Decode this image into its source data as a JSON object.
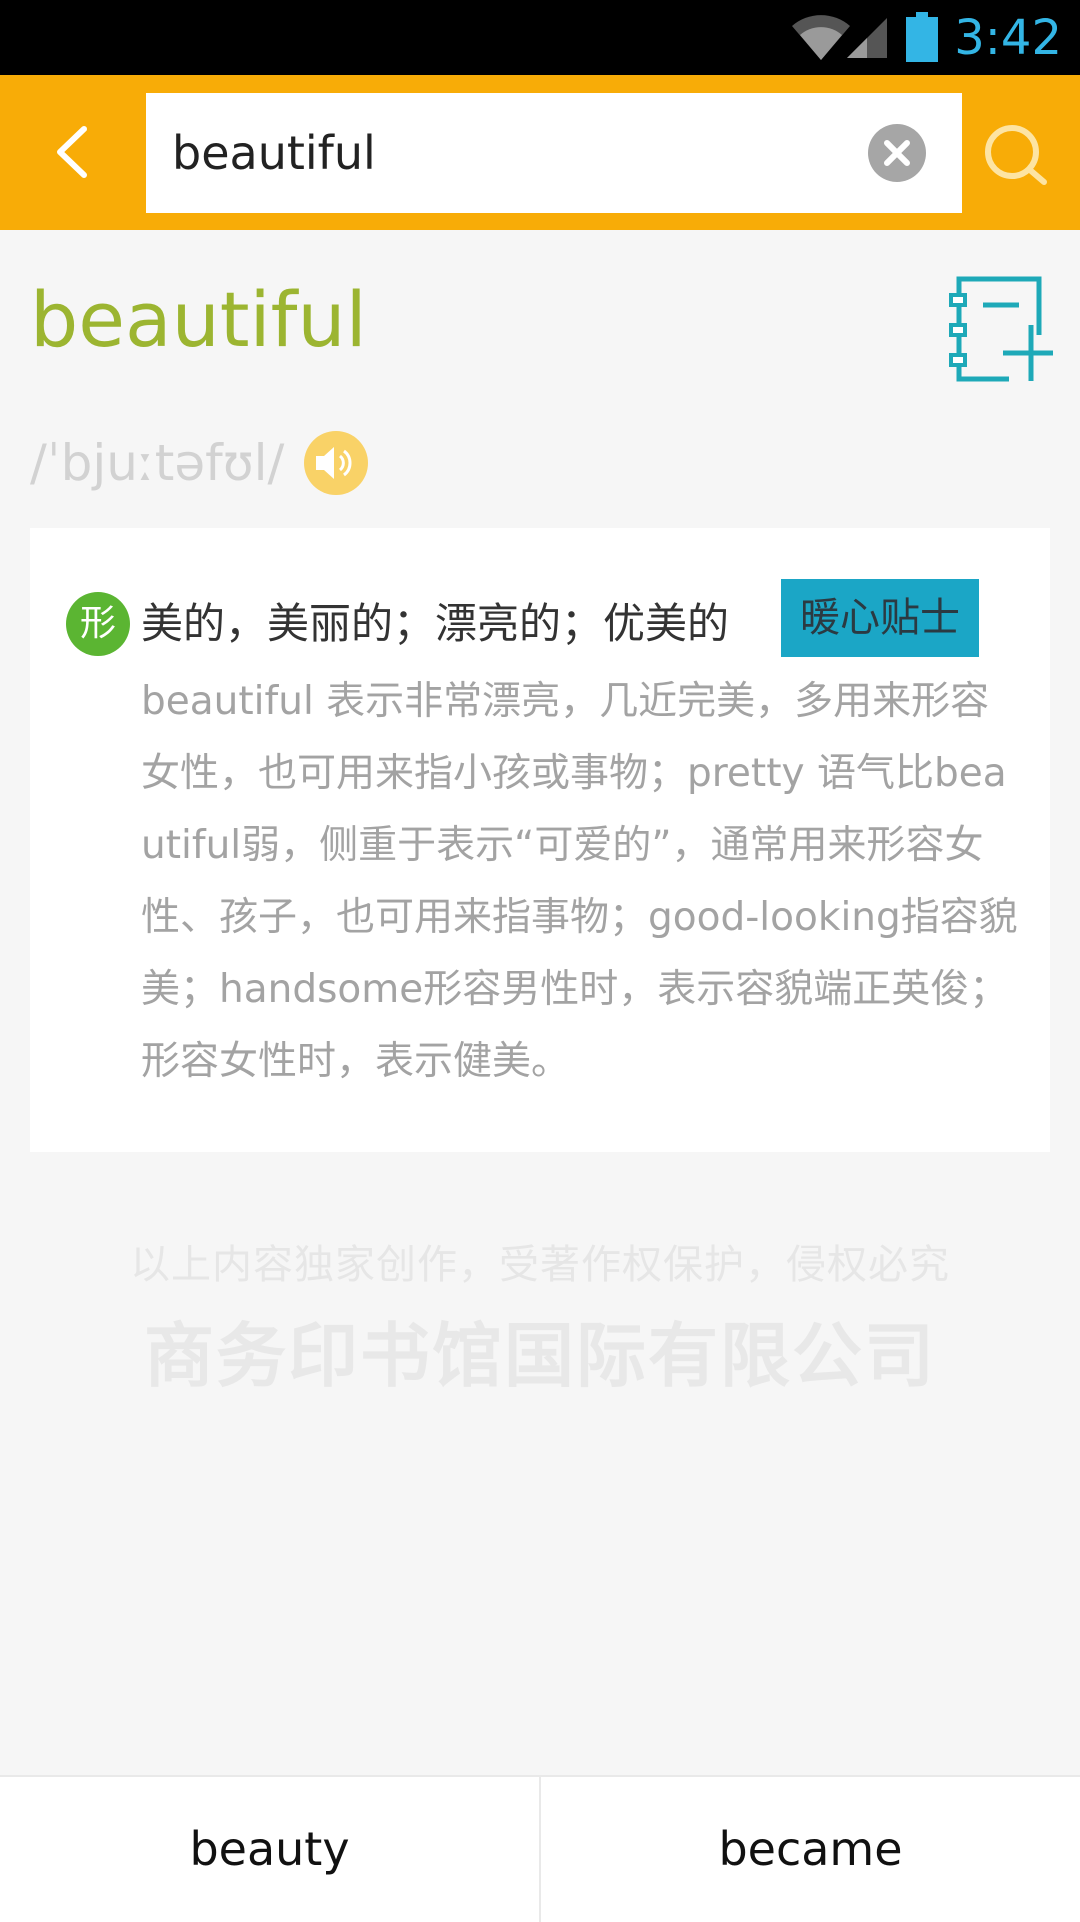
{
  "status_bar": {
    "time": "3:42",
    "icons": [
      "wifi-icon",
      "signal-icon",
      "battery-icon"
    ],
    "time_color": "#33b5e5"
  },
  "header": {
    "back_icon": "chevron-left-icon",
    "search_value": "beautiful",
    "clear_icon": "close-circle-icon",
    "search_icon": "search-icon",
    "background": "#f8ac07"
  },
  "entry": {
    "headword": "beautiful",
    "phonetic": "/ˈbjuːtəfʊl/",
    "speaker_icon": "speaker-icon",
    "wordbook_icon": "add-to-wordbook-icon",
    "headword_color": "#9cb531"
  },
  "definition": {
    "pos": "形",
    "meaning": "美的，美丽的；漂亮的；优美的",
    "tip_label": "暖心贴士",
    "note": "beautiful 表示非常漂亮，几近完美，多用来形容女性，也可用来指小孩或事物；pretty 语气比beautiful弱，侧重于表示“可爱的”，通常用来形容女性、孩子，也可用来指事物；good-looking指容貌美；handsome形容男性时，表示容貌端正英俊；形容女性时，表示健美。"
  },
  "watermark": {
    "line1": "以上内容独家创作，受著作权保护，侵权必究",
    "line2": "商务印书馆国际有限公司"
  },
  "bottom_nav": {
    "prev": "beauty",
    "next": "became"
  }
}
